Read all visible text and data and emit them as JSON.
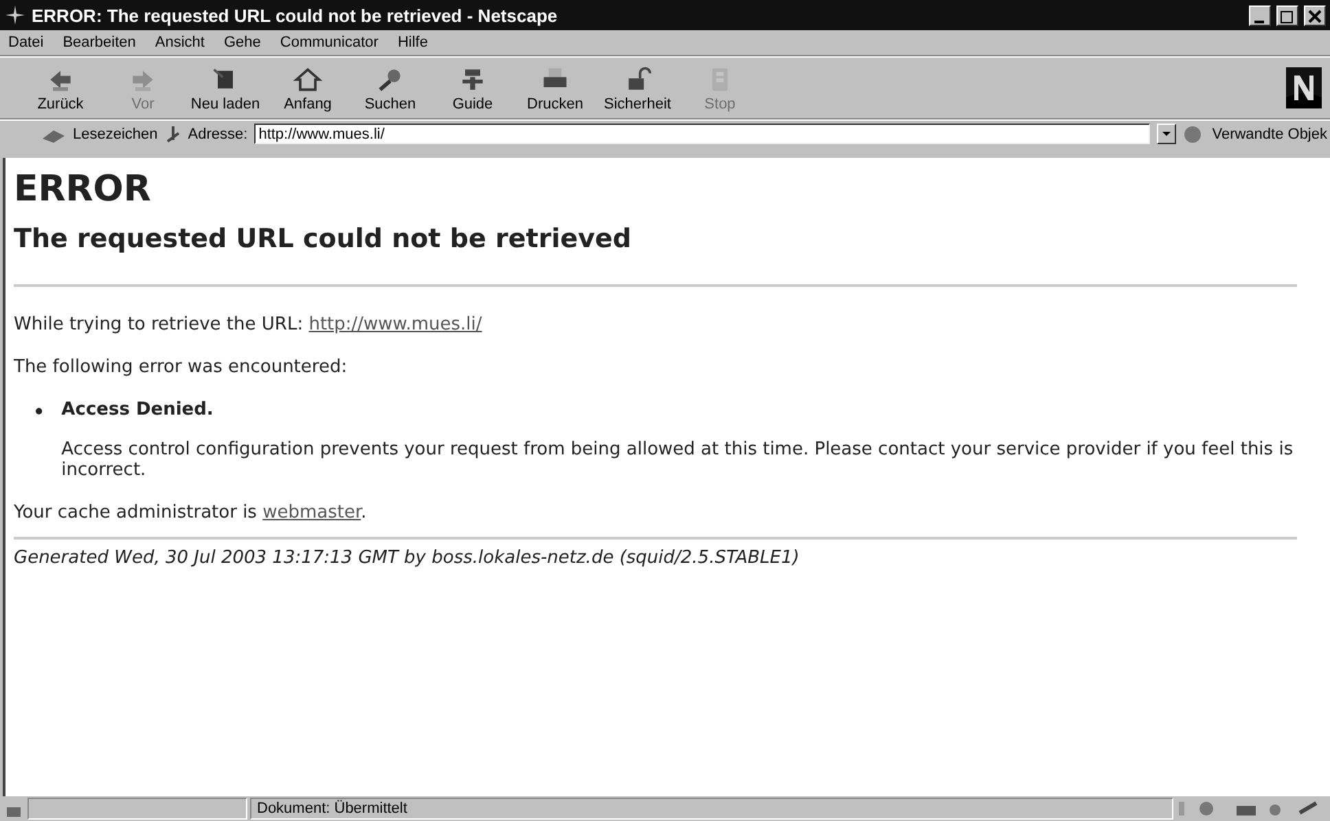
{
  "window": {
    "title": "ERROR: The requested URL could not be retrieved - Netscape"
  },
  "menu": [
    "Datei",
    "Bearbeiten",
    "Ansicht",
    "Gehe",
    "Communicator",
    "Hilfe"
  ],
  "toolbar": [
    {
      "label": "Zurück",
      "kind": "back",
      "disabled": false
    },
    {
      "label": "Vor",
      "kind": "forward",
      "disabled": true
    },
    {
      "label": "Neu laden",
      "kind": "reload",
      "disabled": false
    },
    {
      "label": "Anfang",
      "kind": "home",
      "disabled": false
    },
    {
      "label": "Suchen",
      "kind": "search",
      "disabled": false
    },
    {
      "label": "Guide",
      "kind": "guide",
      "disabled": false
    },
    {
      "label": "Drucken",
      "kind": "print",
      "disabled": false
    },
    {
      "label": "Sicherheit",
      "kind": "security",
      "disabled": false
    },
    {
      "label": "Stop",
      "kind": "stop",
      "disabled": true
    }
  ],
  "location": {
    "bookmarks": "Lesezeichen",
    "address_label": "Adresse:",
    "address": "http://www.mues.li/",
    "related": "Verwandte Objek"
  },
  "page": {
    "heading": "ERROR",
    "subheading": "The requested URL could not be retrieved",
    "url_line": {
      "text": "While trying to retrieve the URL:",
      "link": "http://www.mues.li/"
    },
    "error_intro": "The following error was encountered:",
    "error": {
      "title": "Access Denied.",
      "description": "Access control configuration prevents your request from being allowed at this time. Please contact your service provider if you feel this is incorrect."
    },
    "admin_line": {
      "text": "Your cache administrator is",
      "link": "webmaster",
      "suffix": "."
    },
    "footer": "Generated Wed, 30 Jul 2003 13:17:13 GMT by boss.lokales-netz.de (squid/2.5.STABLE1)"
  },
  "status_bar": {
    "text": "Dokument: Übermittelt"
  }
}
